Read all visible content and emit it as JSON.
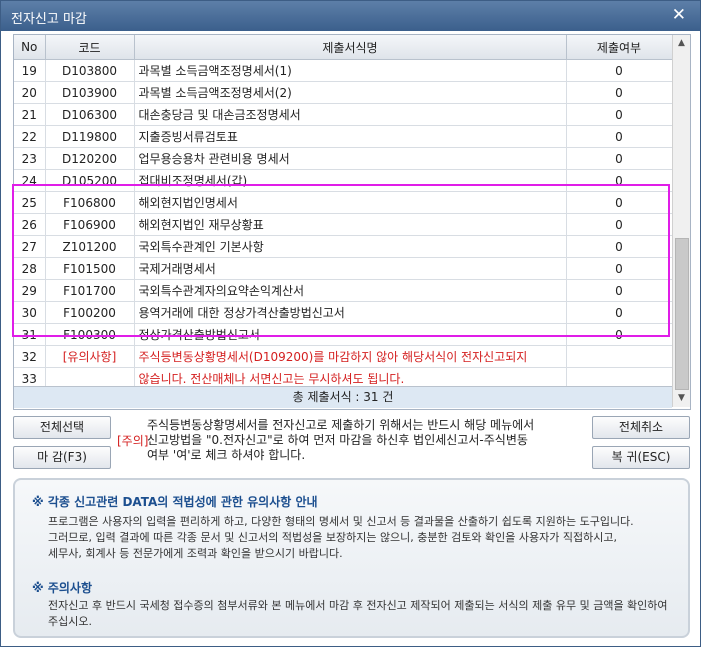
{
  "window": {
    "title": "전자신고 마감",
    "close_glyph": "✕"
  },
  "grid": {
    "headers": [
      "No",
      "코드",
      "제출서식명",
      "제출여부"
    ],
    "rows": [
      {
        "no": "19",
        "code": "D103800",
        "name": "과목별 소득금액조정명세서(1)",
        "sub": "0"
      },
      {
        "no": "20",
        "code": "D103900",
        "name": "과목별 소득금액조정명세서(2)",
        "sub": "0"
      },
      {
        "no": "21",
        "code": "D106300",
        "name": "대손충당금 및 대손금조정명세서",
        "sub": "0"
      },
      {
        "no": "22",
        "code": "D119800",
        "name": "지출증빙서류검토표",
        "sub": "0"
      },
      {
        "no": "23",
        "code": "D120200",
        "name": "업무용승용차 관련비용 명세서",
        "sub": "0"
      },
      {
        "no": "24",
        "code": "D105200",
        "name": "접대비조정명세서(갑)",
        "sub": "0"
      },
      {
        "no": "25",
        "code": "F106800",
        "name": "해외현지법인명세서",
        "sub": "0"
      },
      {
        "no": "26",
        "code": "F106900",
        "name": "해외현지법인 재무상황표",
        "sub": "0"
      },
      {
        "no": "27",
        "code": "Z101200",
        "name": "국외특수관계인 기본사항",
        "sub": "0"
      },
      {
        "no": "28",
        "code": "F101500",
        "name": "국제거래명세서",
        "sub": "0"
      },
      {
        "no": "29",
        "code": "F101700",
        "name": "국외특수관계자의요약손익계산서",
        "sub": "0"
      },
      {
        "no": "30",
        "code": "F100200",
        "name": "용역거래에 대한 정상가격산출방법신고서",
        "sub": "0"
      },
      {
        "no": "31",
        "code": "F100300",
        "name": "정상가격산출방법신고서",
        "sub": "0"
      },
      {
        "no": "32",
        "code": "[유의사항]",
        "name": "주식등변동상황명세서(D109200)를 마감하지 않아 해당서식이 전자신고되지",
        "sub": ""
      },
      {
        "no": "33",
        "code": "",
        "name": "않습니다. 전산매체나 서면신고는 무시하셔도 됩니다.",
        "sub": ""
      }
    ],
    "total": "총 제출서식 : 31 건"
  },
  "buttons": {
    "select_all": "전체선택",
    "close_deadline": "마 감(F3)",
    "cancel_all": "전체취소",
    "restore": "복 귀(ESC)"
  },
  "mid_info": {
    "tag": "[주의]",
    "line1": "주식등변동상황명세서를 전자신고로 제출하기 위해서는 반드시 해당 메뉴에서",
    "line2": "신고방법을 \"0.전자신고\"로 하여 먼저 마감을 하신후 법인세신고서-주식변동",
    "line3": "여부 '여'로 체크 하셔야 합니다."
  },
  "notice": {
    "heading1": "※ 각종 신고관련 DATA의 적법성에 관한 유의사항 안내",
    "p1": "프로그램은 사용자의 입력을 편리하게 하고, 다양한 형태의 명세서 및 신고서 등 결과물을 산출하기 쉽도록 지원하는 도구입니다.",
    "p2": "그러므로, 입력 결과에 따른 각종 문서 및 신고서의 적법성을 보장하지는 않으니, 충분한 검토와 확인을 사용자가 직접하시고,",
    "p3": "세무사, 회계사 등 전문가에게 조력과 확인을 받으시기 바랍니다.",
    "heading2": "※ 주의사항",
    "p4": "전자신고 후 반드시 국세청 접수증의 첨부서류와 본 메뉴에서 마감 후 전자신고 제작되어 제출되는 서식의 제출 유무 및 금액을 확인하여",
    "p5": "주십시오."
  },
  "colors": {
    "highlight": "#e01de8",
    "warning": "#d42020",
    "heading": "#1c4f8f"
  }
}
